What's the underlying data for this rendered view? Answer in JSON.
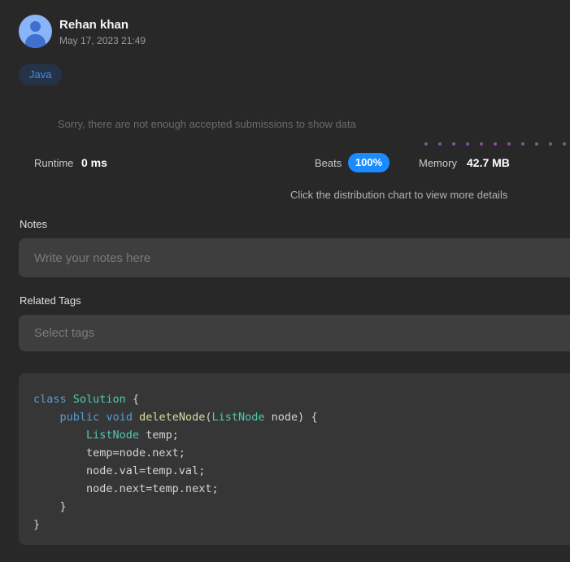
{
  "author": {
    "name": "Rehan khan",
    "date": "May 17, 2023 21:49"
  },
  "language_tag": "Java",
  "stats": {
    "notice": "Sorry, there are not enough accepted submissions to show data",
    "runtime_label": "Runtime",
    "runtime_value": "0 ms",
    "beats_label": "Beats",
    "beats_value": "100%",
    "memory_label": "Memory",
    "memory_value": "42.7 MB",
    "chart_hint": "Click the distribution chart to view more details"
  },
  "notes": {
    "label": "Notes",
    "placeholder": "Write your notes here"
  },
  "related_tags": {
    "label": "Related Tags",
    "placeholder": "Select tags"
  },
  "code": {
    "lines": [
      [
        {
          "t": "kw",
          "v": "class"
        },
        {
          "t": "",
          "v": " "
        },
        {
          "t": "ty",
          "v": "Solution"
        },
        {
          "t": "",
          "v": " {"
        }
      ],
      [
        {
          "t": "",
          "v": "    "
        },
        {
          "t": "kw",
          "v": "public"
        },
        {
          "t": "",
          "v": " "
        },
        {
          "t": "kw",
          "v": "void"
        },
        {
          "t": "",
          "v": " "
        },
        {
          "t": "fn",
          "v": "deleteNode"
        },
        {
          "t": "",
          "v": "("
        },
        {
          "t": "ty",
          "v": "ListNode"
        },
        {
          "t": "",
          "v": " node) {"
        }
      ],
      [
        {
          "t": "",
          "v": "        "
        },
        {
          "t": "ty",
          "v": "ListNode"
        },
        {
          "t": "",
          "v": " temp;"
        }
      ],
      [
        {
          "t": "",
          "v": "        temp=node.next;"
        }
      ],
      [
        {
          "t": "",
          "v": "        node.val=temp.val;"
        }
      ],
      [
        {
          "t": "",
          "v": "        node.next=temp.next;"
        }
      ],
      [
        {
          "t": "",
          "v": "    }"
        }
      ],
      [
        {
          "t": "",
          "v": "}"
        }
      ]
    ]
  },
  "colors": {
    "background": "#282828",
    "accent": "#1a8cff",
    "tag_text": "#3f8cf5"
  }
}
